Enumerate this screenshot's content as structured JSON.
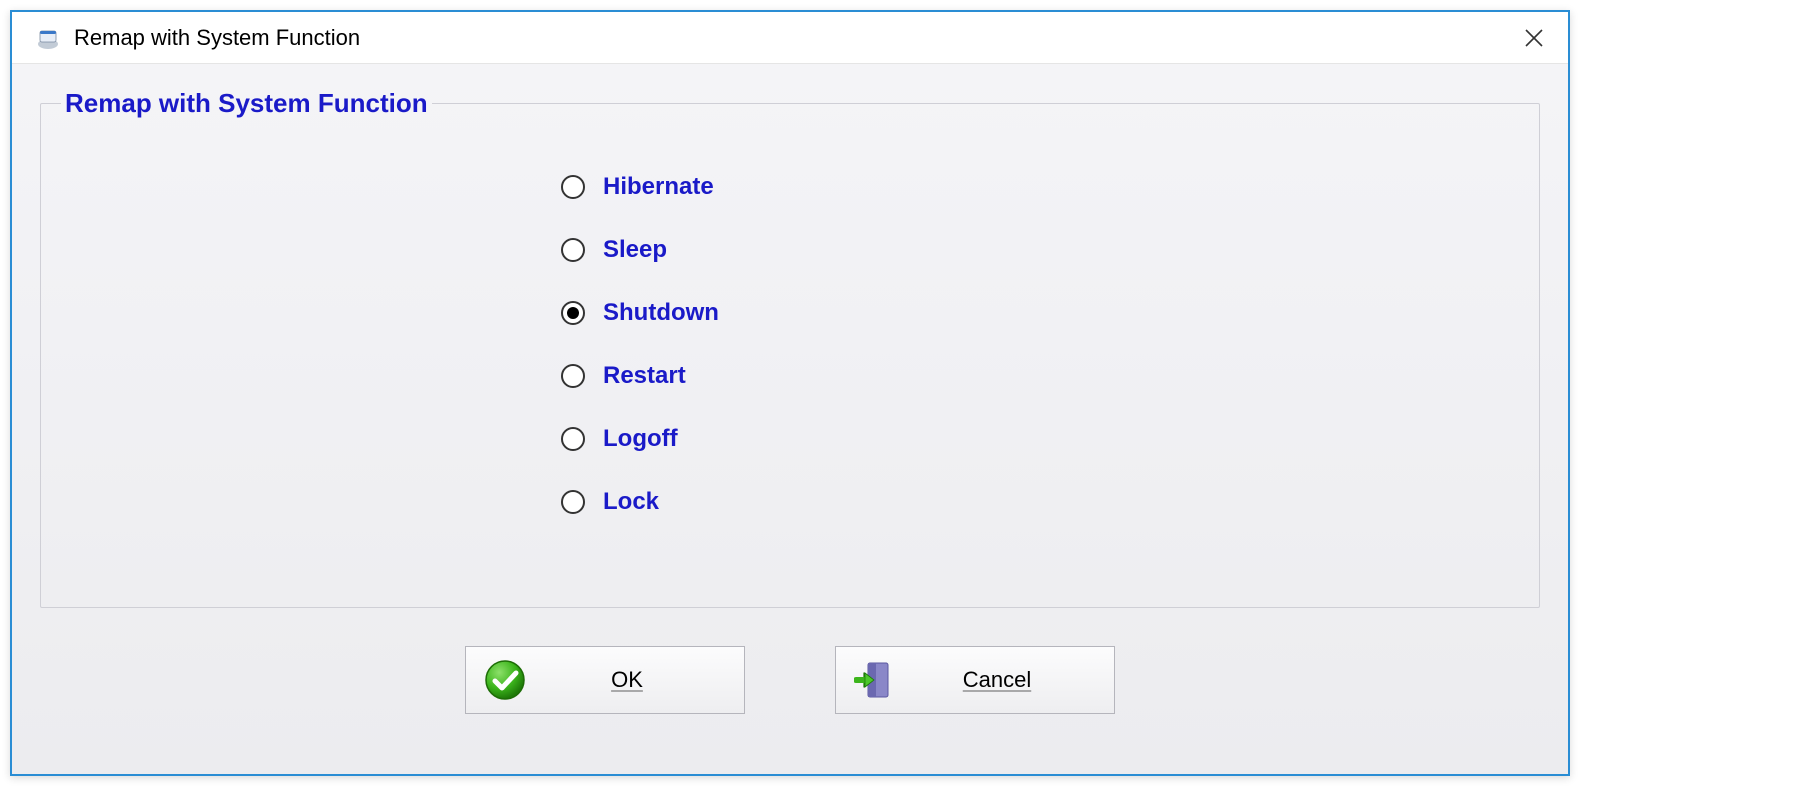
{
  "window": {
    "title": "Remap with System Function"
  },
  "group": {
    "legend": "Remap with System Function",
    "selected_index": 2,
    "options": [
      {
        "label": "Hibernate"
      },
      {
        "label": "Sleep"
      },
      {
        "label": "Shutdown"
      },
      {
        "label": "Restart"
      },
      {
        "label": "Logoff"
      },
      {
        "label": "Lock"
      }
    ]
  },
  "buttons": {
    "ok": "OK",
    "cancel": "Cancel"
  }
}
